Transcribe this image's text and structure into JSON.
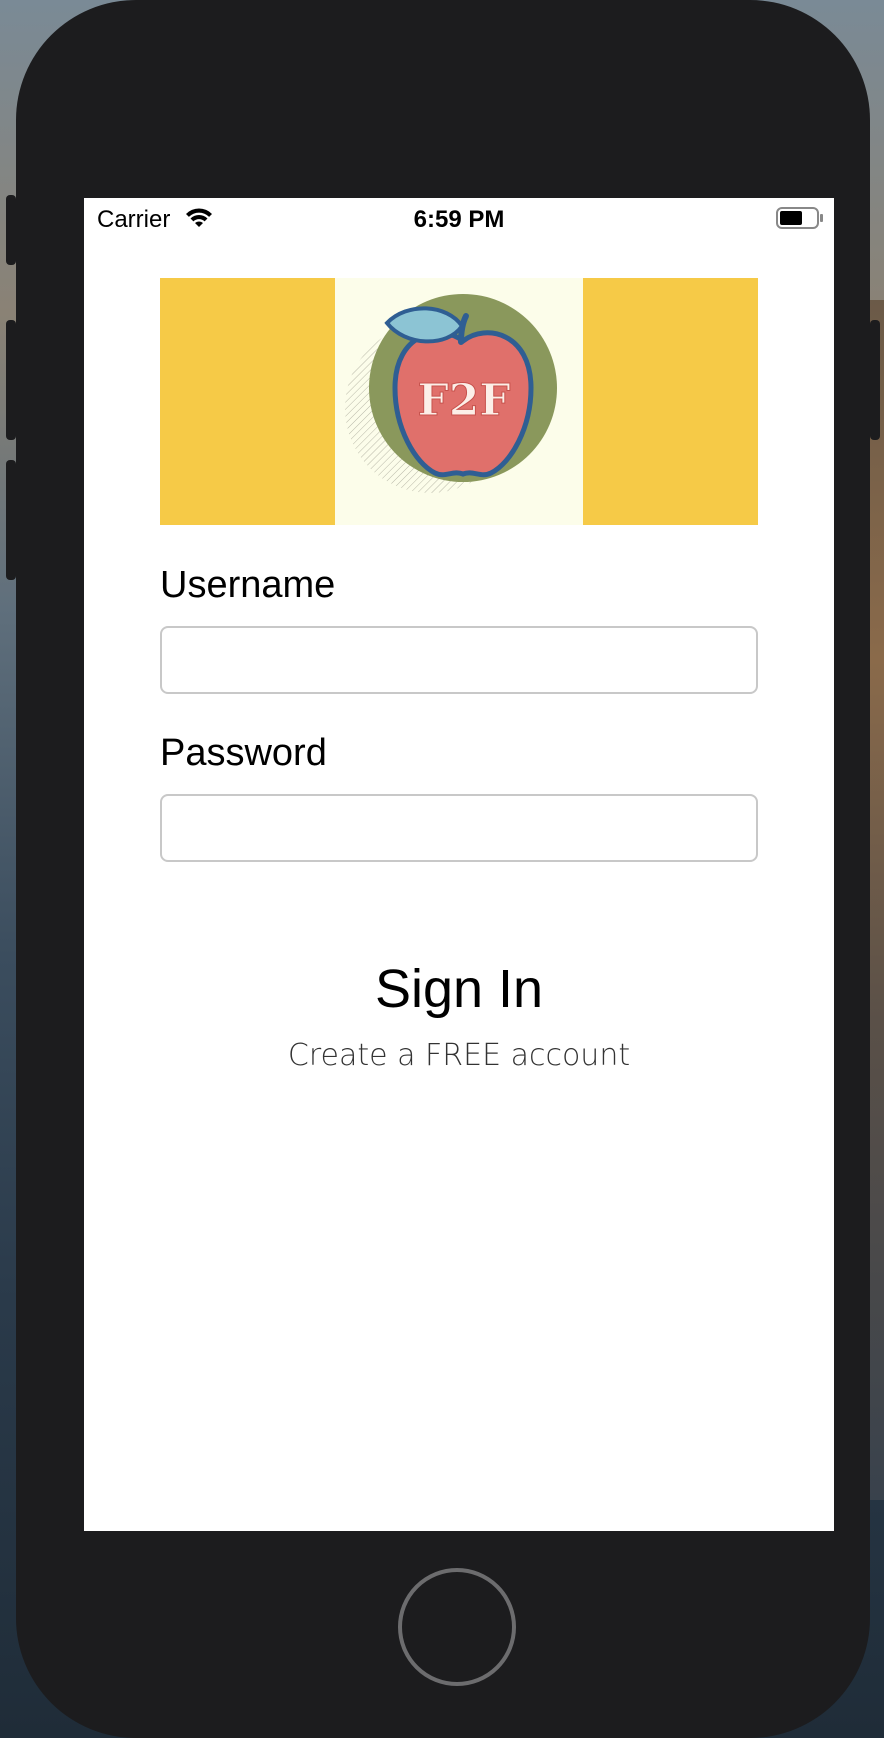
{
  "status_bar": {
    "carrier": "Carrier",
    "time": "6:59 PM",
    "icons": [
      "wifi-icon",
      "battery-icon"
    ]
  },
  "logo": {
    "text": "F2F",
    "icon": "apple-logo",
    "colors": {
      "banner": "#f6ca47",
      "background": "#fcfdea",
      "circle": "#8a985c",
      "apple": "#e0706b",
      "outline": "#2f5e93",
      "leaf": "#8cc4d4"
    }
  },
  "form": {
    "username_label": "Username",
    "username_value": "",
    "password_label": "Password",
    "password_value": ""
  },
  "actions": {
    "sign_in_label": "Sign In",
    "create_account_label": "Create a FREE account"
  }
}
